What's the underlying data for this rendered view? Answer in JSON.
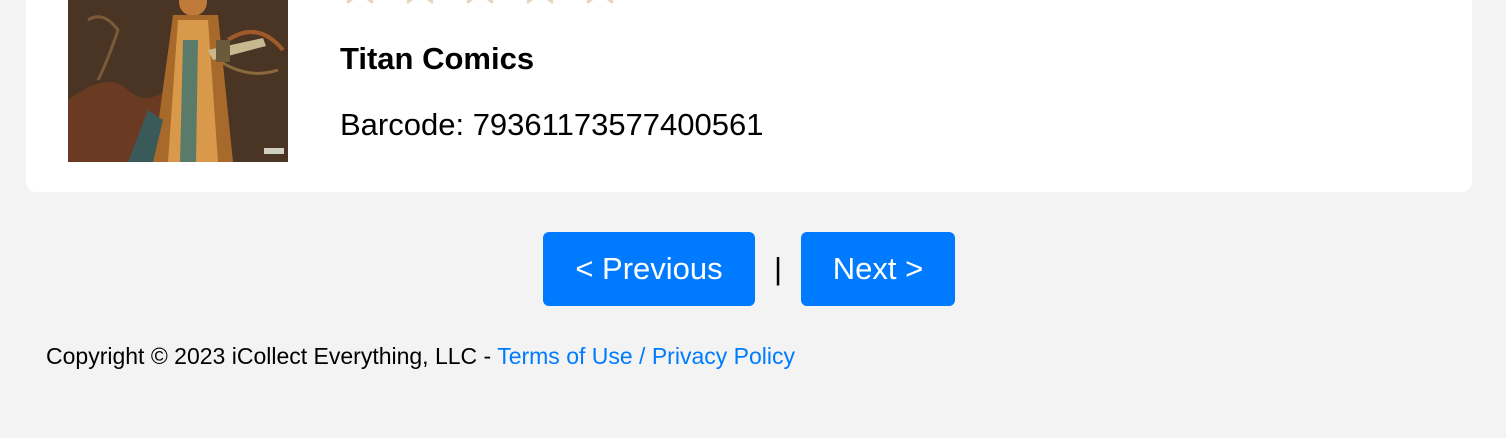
{
  "item": {
    "rating_icon": "star-outline-icon",
    "rating_star_color": "#e6d6c6",
    "rating_filled": 0,
    "rating_max": 5,
    "publisher": "Titan Comics",
    "barcode": "Barcode: 79361173577400561"
  },
  "pagination": {
    "previous_label": "< Previous",
    "separator": "|",
    "next_label": "Next >"
  },
  "footer": {
    "copyright": "Copyright © 2023 iCollect Everything, LLC - ",
    "terms_link": "Terms of Use / Privacy Policy"
  },
  "colors": {
    "accent": "#007bff",
    "page_background": "#f3f3f3",
    "card_background": "#ffffff"
  }
}
